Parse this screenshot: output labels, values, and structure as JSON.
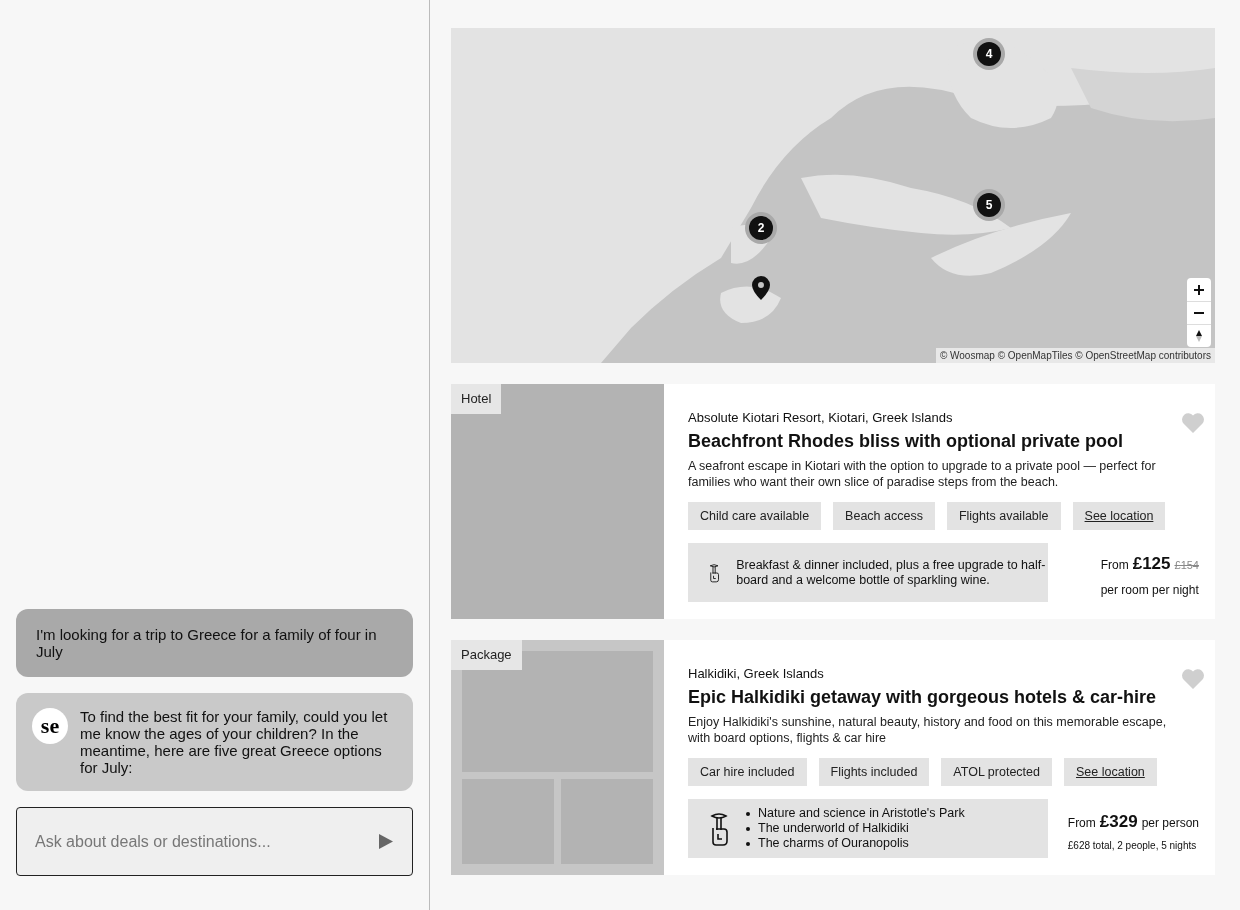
{
  "chat": {
    "messages": [
      {
        "kind": "user",
        "text": "I'm looking for a trip to Greece for a family of four in July"
      },
      {
        "kind": "assistant",
        "avatar": "se",
        "text": "To find the best fit for your family, could you let me know the ages of your children? In the meantime, here are five great Greece options for July:"
      }
    ],
    "input": {
      "placeholder": "Ask about deals or destinations..."
    }
  },
  "map": {
    "clusters": [
      {
        "count": "4"
      },
      {
        "count": "5"
      },
      {
        "count": "2"
      }
    ],
    "attribution": "© Woosmap © OpenMapTiles © OpenStreetMap contributors"
  },
  "results": [
    {
      "kind": "hotel",
      "badge": "Hotel",
      "location": "Absolute Kiotari Resort, Kiotari, Greek Islands",
      "title": "Beachfront Rhodes bliss with optional private pool",
      "description": "A seafront escape in Kiotari with the option to upgrade to a private pool — perfect for families who want their own slice of paradise steps from the beach.",
      "tags": [
        "Child care available",
        "Beach access",
        "Flights available"
      ],
      "link": "See location",
      "favorite": false,
      "highlight": {
        "kind": "text",
        "text": "Breakfast & dinner included, plus a free upgrade to half-board and a welcome bottle of sparkling wine."
      },
      "price": {
        "from": "From",
        "amount": "£125",
        "was": "£154",
        "unit": "per room per night"
      }
    },
    {
      "kind": "package",
      "badge": "Package",
      "location": "Halkidiki, Greek Islands",
      "title": "Epic Halkidiki getaway with gorgeous hotels & car-hire",
      "description": "Enjoy Halkidiki's sunshine, natural beauty, history and food on this memorable escape, with board options, flights & car hire",
      "tags": [
        "Car hire included",
        "Flights included",
        "ATOL protected"
      ],
      "link": "See location",
      "favorite": false,
      "highlight": {
        "kind": "list",
        "items": [
          "Nature and science in Aristotle's Park",
          "The underworld of Halkidiki",
          "The charms of Ouranopolis"
        ]
      },
      "price": {
        "from": "From",
        "amount": "£329",
        "unit": "per person",
        "note": "£628 total, 2 people, 5 nights"
      }
    }
  ]
}
